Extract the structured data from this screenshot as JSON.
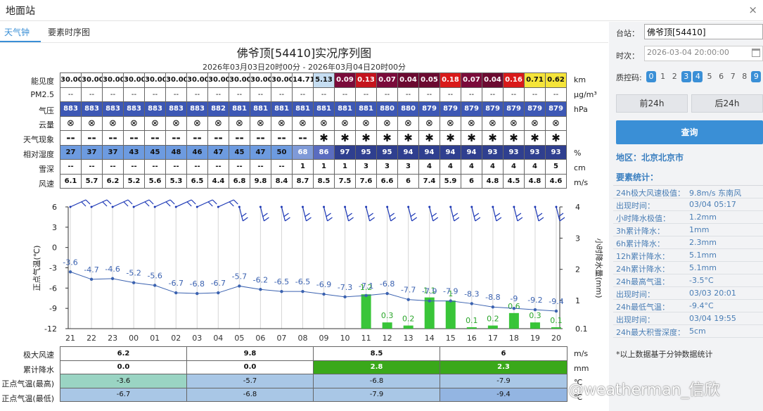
{
  "window": {
    "title": "地面站",
    "close_glyph": "×"
  },
  "tabs": [
    "天气钟",
    "要素时序图"
  ],
  "chart": {
    "title": "佛爷顶[54410]实况序列图",
    "subtitle": "2026年03月03日20时00分 - 2026年03月04日20时00分"
  },
  "hours": [
    "21",
    "22",
    "23",
    "00",
    "01",
    "02",
    "03",
    "04",
    "05",
    "06",
    "07",
    "08",
    "09",
    "10",
    "11",
    "12",
    "13",
    "14",
    "15",
    "16",
    "17",
    "18",
    "19",
    "20"
  ],
  "table_rows": [
    {
      "label": "能见度",
      "unit": "km",
      "values": [
        "30.00",
        "30.00",
        "30.00",
        "30.00",
        "30.00",
        "30.00",
        "30.00",
        "30.00",
        "30.00",
        "30.00",
        "30.00",
        "14.71",
        "5.13",
        "0.09",
        "0.13",
        "0.07",
        "0.04",
        "0.05",
        "0.18",
        "0.07",
        "0.04",
        "0.16",
        "0.71",
        "0.62"
      ],
      "colors": [
        "#ffffff",
        "#ffffff",
        "#ffffff",
        "#ffffff",
        "#ffffff",
        "#ffffff",
        "#ffffff",
        "#ffffff",
        "#ffffff",
        "#ffffff",
        "#ffffff",
        "#ffffff",
        "#c6def2",
        "#7a0b3a",
        "#c4141d",
        "#7a0b3a",
        "#6b0a30",
        "#6b0a30",
        "#d91a1a",
        "#7a0b3a",
        "#6b0a30",
        "#d91a1a",
        "#f5e43a",
        "#f5e43a"
      ],
      "textcolors": [
        "#111",
        "#111",
        "#111",
        "#111",
        "#111",
        "#111",
        "#111",
        "#111",
        "#111",
        "#111",
        "#111",
        "#111",
        "#111",
        "#fff",
        "#fff",
        "#fff",
        "#fff",
        "#fff",
        "#fff",
        "#fff",
        "#fff",
        "#fff",
        "#111",
        "#111"
      ]
    },
    {
      "label": "PM2.5",
      "unit": "μg/m³",
      "values": [
        "--",
        "--",
        "--",
        "--",
        "--",
        "--",
        "--",
        "--",
        "--",
        "--",
        "--",
        "--",
        "--",
        "--",
        "--",
        "--",
        "--",
        "--",
        "--",
        "--",
        "--",
        "--",
        "--",
        "--"
      ]
    },
    {
      "label": "气压",
      "unit": "hPa",
      "values": [
        "883",
        "883",
        "883",
        "883",
        "883",
        "883",
        "883",
        "882",
        "881",
        "881",
        "881",
        "881",
        "881",
        "881",
        "881",
        "880",
        "880",
        "879",
        "879",
        "879",
        "879",
        "879",
        "879",
        "879"
      ],
      "bg": "#3d58b5",
      "fg": "#ffffff"
    },
    {
      "label": "云量",
      "unit": "",
      "values": [
        "⊗",
        "⊗",
        "⊗",
        "⊗",
        "⊗",
        "⊗",
        "⊗",
        "⊗",
        "⊗",
        "⊗",
        "⊗",
        "⊗",
        "⊗",
        "⊗",
        "⊗",
        "⊗",
        "⊗",
        "⊗",
        "⊗",
        "⊗",
        "⊗",
        "⊗",
        "⊗",
        "⊗"
      ]
    },
    {
      "label": "天气现象",
      "unit": "",
      "values": [
        "--",
        "--",
        "--",
        "--",
        "--",
        "--",
        "--",
        "--",
        "--",
        "--",
        "--",
        "--",
        "✱",
        "✱",
        "✱",
        "✱",
        "✱",
        "✱",
        "✱",
        "✱",
        "✱",
        "✱",
        "✱",
        "✱"
      ]
    },
    {
      "label": "相对湿度",
      "unit": "%",
      "values": [
        "27",
        "37",
        "37",
        "43",
        "45",
        "48",
        "46",
        "47",
        "45",
        "47",
        "50",
        "68",
        "86",
        "97",
        "95",
        "95",
        "94",
        "94",
        "94",
        "94",
        "93",
        "93",
        "93",
        "93"
      ]
    },
    {
      "label": "雪深",
      "unit": "cm",
      "values": [
        "--",
        "--",
        "--",
        "--",
        "--",
        "--",
        "--",
        "--",
        "--",
        "--",
        "--",
        "1",
        "1",
        "1",
        "3",
        "3",
        "3",
        "4",
        "4",
        "4",
        "4",
        "4",
        "4",
        "5"
      ]
    },
    {
      "label": "风速",
      "unit": "m/s",
      "values": [
        "6.1",
        "5.7",
        "6.2",
        "5.2",
        "5.6",
        "5.3",
        "6.5",
        "4.4",
        "6.8",
        "9.8",
        "8.4",
        "8.7",
        "8.5",
        "7.5",
        "7.6",
        "6.6",
        "6",
        "7.4",
        "5.9",
        "6",
        "4.8",
        "4.5",
        "4.8",
        "4.6"
      ]
    }
  ],
  "axis": {
    "left_label": "正点气温(℃)",
    "right_label": "小时降水量(mm)",
    "left_ticks": [
      "6",
      "3",
      "0",
      "-3",
      "-6",
      "-9",
      "-12"
    ],
    "right_ticks": [
      "4",
      "3",
      "2",
      "1",
      "0.1"
    ]
  },
  "chart_data": {
    "type": "line",
    "x": [
      "21",
      "22",
      "23",
      "00",
      "01",
      "02",
      "03",
      "04",
      "05",
      "06",
      "07",
      "08",
      "09",
      "10",
      "11",
      "12",
      "13",
      "14",
      "15",
      "16",
      "17",
      "18",
      "19",
      "20"
    ],
    "series": [
      {
        "name": "正点气温",
        "values": [
          -3.6,
          -4.7,
          -4.6,
          -5.2,
          -5.6,
          -6.7,
          -6.8,
          -6.7,
          -5.7,
          -6.2,
          -6.5,
          -6.5,
          -6.9,
          -7.3,
          -7.1,
          -6.8,
          -7.7,
          -7.9,
          -7.9,
          -8.3,
          -8.8,
          -9,
          -9.2,
          -9.4
        ],
        "color": "#3b62b0"
      },
      {
        "name": "小时降水量",
        "type": "bar",
        "values": [
          0,
          0,
          0,
          0,
          0,
          0,
          0,
          0,
          0,
          0,
          0,
          0,
          0,
          0,
          1.2,
          0.3,
          0.2,
          1.1,
          1,
          0.1,
          0.2,
          0.6,
          0.3,
          0.1
        ],
        "color": "#2ec22e"
      }
    ],
    "left_ylim": [
      -12,
      6
    ],
    "right_ylim": [
      0.1,
      4
    ],
    "xlabel": "",
    "ylabel_left": "正点气温(℃)",
    "ylabel_right": "小时降水量(mm)"
  },
  "bottom_rows": [
    {
      "label": "极大风速",
      "unit": "m/s",
      "cells": [
        {
          "v": "6.2",
          "bg": "#ffffff"
        },
        {
          "v": "9.8",
          "bg": "#ffffff"
        },
        {
          "v": "8.5",
          "bg": "#ffffff"
        },
        {
          "v": "6",
          "bg": "#ffffff"
        }
      ]
    },
    {
      "label": "累计降水",
      "unit": "mm",
      "cells": [
        {
          "v": "0.0",
          "bg": "#ffffff",
          "fg": "#111"
        },
        {
          "v": "0.0",
          "bg": "#ffffff",
          "fg": "#111"
        },
        {
          "v": "2.8",
          "bg": "#3aa81a",
          "fg": "#fff"
        },
        {
          "v": "2.3",
          "bg": "#3aa81a",
          "fg": "#fff"
        }
      ]
    },
    {
      "label": "正点气温(最高)",
      "unit": "℃",
      "cells": [
        {
          "v": "-3.6",
          "bg": "#9ad4c3"
        },
        {
          "v": "-5.7",
          "bg": "#a9c7e6"
        },
        {
          "v": "-6.8",
          "bg": "#a9c7e6"
        },
        {
          "v": "-7.9",
          "bg": "#a9c7e6"
        }
      ]
    },
    {
      "label": "正点气温(最低)",
      "unit": "℃",
      "cells": [
        {
          "v": "-6.7",
          "bg": "#a9c7e6"
        },
        {
          "v": "-6.8",
          "bg": "#a9c7e6"
        },
        {
          "v": "-7.9",
          "bg": "#a9c7e6"
        },
        {
          "v": "-9.4",
          "bg": "#93b5e2"
        }
      ]
    }
  ],
  "panel": {
    "station_label": "台站：",
    "station_value": "佛爷顶[54410]",
    "time_label": "时次：",
    "time_value": "2026-03-04 20:00:00",
    "qc_label": "质控码:",
    "qc_codes": [
      "0",
      "1",
      "2",
      "3",
      "4",
      "5",
      "6",
      "7",
      "8",
      "9"
    ],
    "qc_active": [
      true,
      false,
      false,
      true,
      true,
      false,
      false,
      false,
      false,
      true
    ],
    "prev_btn": "前24h",
    "next_btn": "后24h",
    "query_btn": "查询",
    "region": "地区：北京北京市",
    "stats_title": "要素统计：",
    "stats": [
      {
        "k": "24h极大风速极值：",
        "v": "9.8m/s 东南风"
      },
      {
        "k": "出现时间：",
        "v": "03/04 05:17"
      },
      {
        "k": "小时降水极值：",
        "v": "1.2mm"
      },
      {
        "k": "3h累计降水：",
        "v": "1mm"
      },
      {
        "k": "6h累计降水：",
        "v": "2.3mm"
      },
      {
        "k": "12h累计降水：",
        "v": "5.1mm"
      },
      {
        "k": "24h累计降水：",
        "v": "5.1mm"
      },
      {
        "k": "24h最高气温：",
        "v": "-3.5°C"
      },
      {
        "k": "出现时间：",
        "v": "03/03 20:01"
      },
      {
        "k": "24h最低气温：",
        "v": "-9.4°C"
      },
      {
        "k": "出现时间：",
        "v": "03/04 19:55"
      },
      {
        "k": "24h最大积雪深度：",
        "v": "5cm"
      }
    ],
    "note": "*以上数据基于分钟数据统计"
  },
  "watermark": "@weatherman_信欣"
}
